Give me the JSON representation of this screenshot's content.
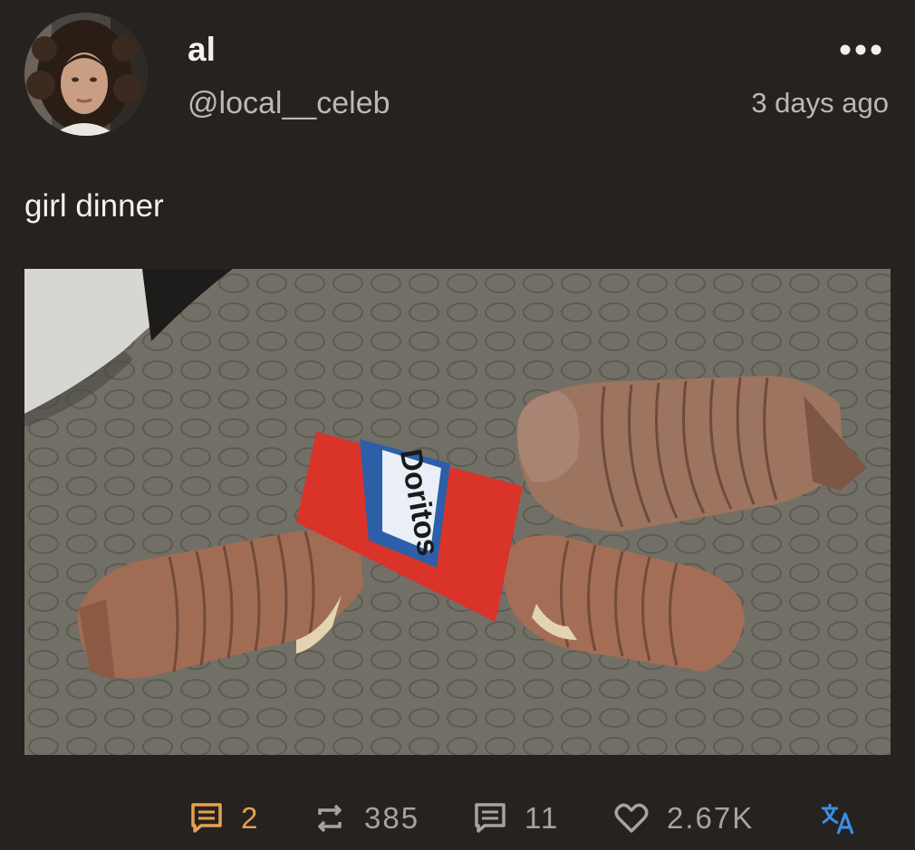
{
  "post": {
    "display_name": "al",
    "handle": "@local__celeb",
    "timestamp": "3 days ago",
    "text": "girl dinner"
  },
  "image": {
    "snack_bag_brand": "Doritos",
    "description_icon": "photo"
  },
  "actions": {
    "replies_count": "2",
    "reposts_count": "385",
    "quotes_count": "11",
    "likes_count": "2.67K"
  },
  "colors": {
    "background": "#252220",
    "accent_active": "#e7a150",
    "muted_text": "#a9a39e",
    "translate_blue": "#3a8ee6"
  },
  "icons": {
    "more": "more-horizontal-icon",
    "replies": "chat-bubble-icon",
    "reposts": "repost-icon",
    "quotes": "comment-icon",
    "likes": "heart-icon",
    "translate": "translate-icon"
  }
}
